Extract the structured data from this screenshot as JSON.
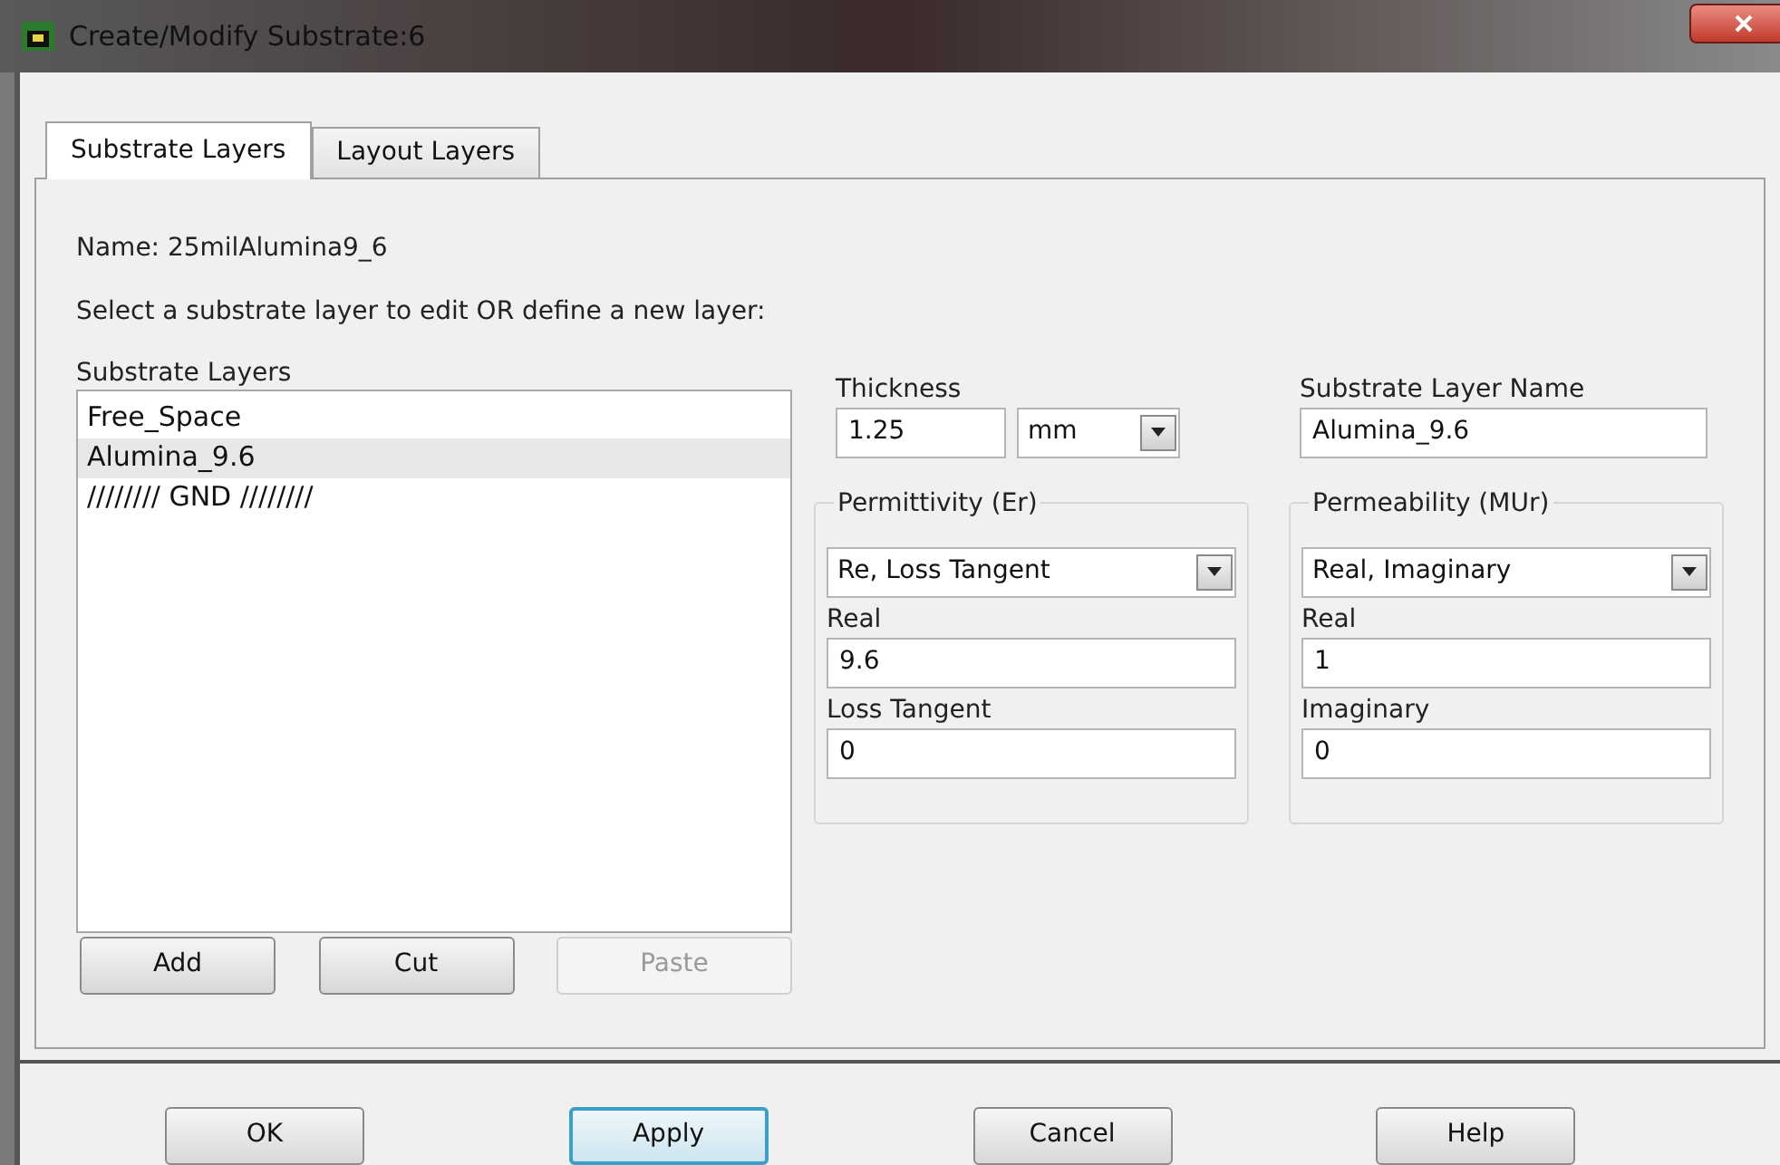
{
  "window": {
    "title": "Create/Modify Substrate:6"
  },
  "tabs": [
    {
      "label": "Substrate Layers",
      "selected": true
    },
    {
      "label": "Layout Layers",
      "selected": false
    }
  ],
  "name_line": "Name: 25milAlumina9_6",
  "instruction": "Select a substrate layer to edit OR define a new layer:",
  "layers": {
    "label": "Substrate Layers",
    "items": [
      {
        "label": "Free_Space",
        "selected": false
      },
      {
        "label": "Alumina_9.6",
        "selected": true
      },
      {
        "label": "//////// GND ////////",
        "selected": false
      }
    ],
    "buttons": [
      {
        "label": "Add",
        "disabled": false
      },
      {
        "label": "Cut",
        "disabled": false
      },
      {
        "label": "Paste",
        "disabled": true
      }
    ]
  },
  "thickness": {
    "label": "Thickness",
    "value": "1.25",
    "unit": "mm"
  },
  "layer_name": {
    "label": "Substrate Layer Name",
    "value": "Alumina_9.6"
  },
  "permittivity": {
    "title": "Permittivity (Er)",
    "mode": "Re, Loss Tangent",
    "fields": [
      {
        "label": "Real",
        "value": "9.6"
      },
      {
        "label": "Loss Tangent",
        "value": "0"
      }
    ]
  },
  "permeability": {
    "title": "Permeability (MUr)",
    "mode": "Real, Imaginary",
    "fields": [
      {
        "label": "Real",
        "value": "1"
      },
      {
        "label": "Imaginary",
        "value": "0"
      }
    ]
  },
  "buttons": [
    {
      "label": "OK",
      "focused": false
    },
    {
      "label": "Apply",
      "focused": true
    },
    {
      "label": "Cancel",
      "focused": false
    },
    {
      "label": "Help",
      "focused": false
    }
  ]
}
